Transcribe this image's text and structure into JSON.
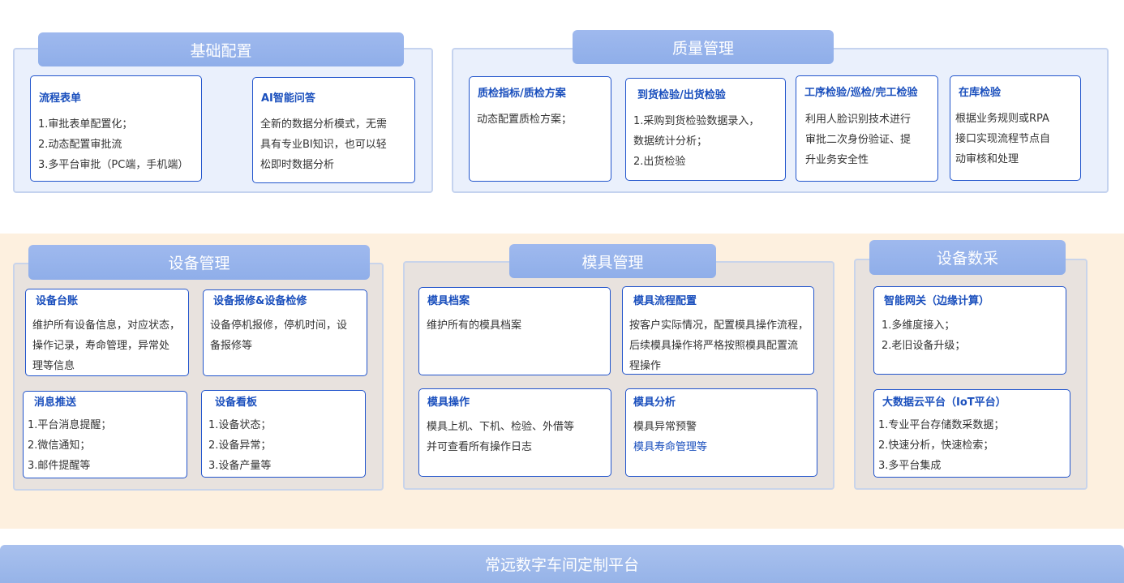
{
  "sections": {
    "basic": {
      "title": "基础配置",
      "cards": [
        {
          "title": "流程表单",
          "lines": [
            "1.审批表单配置化；",
            "2.动态配置审批流",
            "3.多平台审批（PC端，手机端）"
          ]
        },
        {
          "title": "AI智能问答",
          "lines": [
            "全新的数据分析模式，无需",
            "具有专业BI知识，也可以轻",
            "松即时数据分析"
          ]
        }
      ]
    },
    "quality": {
      "title": "质量管理",
      "cards": [
        {
          "title": "质检指标/质检方案",
          "lines": [
            "动态配置质检方案；"
          ]
        },
        {
          "title": "到货检验/出货检验",
          "lines": [
            "1.采购到货检验数据录入，",
            "数据统计分析；",
            "2.出货检验"
          ]
        },
        {
          "title": "工序检验/巡检/完工检验",
          "lines": [
            "利用人脸识别技术进行",
            "审批二次身份验证、提",
            "升业务安全性"
          ]
        },
        {
          "title": "在库检验",
          "lines": [
            "根据业务规则或RPA",
            "接口实现流程节点自",
            "动审核和处理"
          ]
        }
      ]
    },
    "equipment": {
      "title": "设备管理",
      "cards": [
        {
          "title": "设备台账",
          "lines": [
            "维护所有设备信息，对应状态，",
            "操作记录，寿命管理，异常处",
            "理等信息"
          ]
        },
        {
          "title": "设备报修&设备检修",
          "lines": [
            "设备停机报修，停机时间，设",
            "备报修等"
          ]
        },
        {
          "title": "消息推送",
          "lines": [
            "1.平台消息提醒；",
            "2.微信通知；",
            "3.邮件提醒等"
          ]
        },
        {
          "title": "设备看板",
          "lines": [
            "1.设备状态；",
            "2.设备异常；",
            "3.设备产量等"
          ]
        }
      ]
    },
    "mold": {
      "title": "模具管理",
      "cards": [
        {
          "title": "模具档案",
          "lines": [
            "维护所有的模具档案"
          ]
        },
        {
          "title": "模具流程配置",
          "lines": [
            "按客户实际情况，配置模具操作流程，",
            "后续模具操作将严格按照模具配置流",
            "程操作"
          ]
        },
        {
          "title": "模具操作",
          "lines": [
            "模具上机、下机、检验、外借等",
            "并可查看所有操作日志"
          ]
        },
        {
          "title": "模具分析",
          "lines": [
            "模具异常预警",
            "模具寿命管理等"
          ]
        }
      ]
    },
    "collect": {
      "title": "设备数采",
      "cards": [
        {
          "title": "智能网关（边缘计算）",
          "lines": [
            "1.多维度接入；",
            "2.老旧设备升级；"
          ]
        },
        {
          "title": "大数据云平台（IoT平台）",
          "lines": [
            "1.专业平台存储数采数据；",
            "2.快速分析，快速检索；",
            "3.多平台集成"
          ]
        }
      ]
    }
  },
  "platform": "常远数字车间定制平台",
  "colors": {
    "header": "#94b2ea",
    "card_border": "#2255cc",
    "title_text": "#1a4fbd",
    "band": "#fdf0df"
  }
}
